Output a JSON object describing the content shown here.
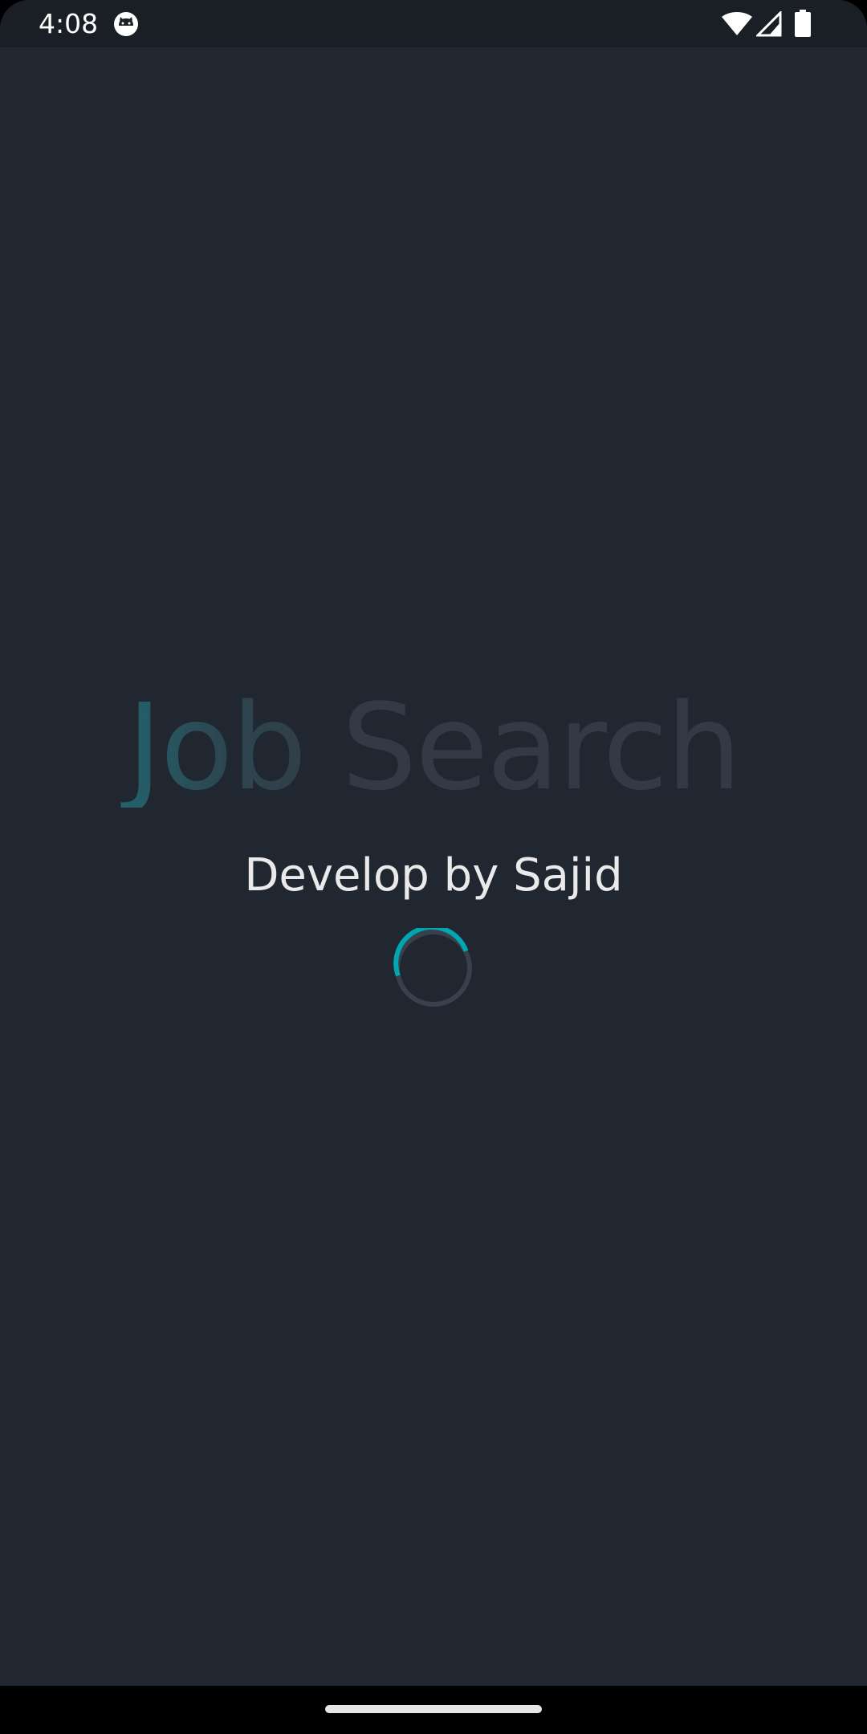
{
  "status_bar": {
    "time": "4:08",
    "app_icon": "android-cat-icon",
    "wifi_icon": "wifi-icon",
    "signal_icon": "cell-signal-icon",
    "battery_icon": "battery-icon"
  },
  "splash": {
    "title": "Job Search",
    "subtitle": "Develop by Sajid",
    "loading_indicator": "spinner-icon"
  },
  "colors": {
    "background": "#212731",
    "status_bar": "#1a1e25",
    "accent": "#00a7b3",
    "spinner_track": "#3a404b",
    "title_dim": "#343a45",
    "subtitle": "#eaeaea"
  }
}
